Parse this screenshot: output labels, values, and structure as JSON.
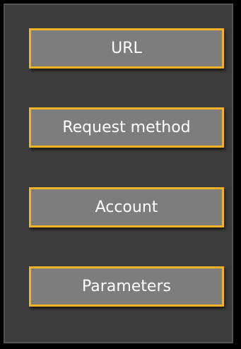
{
  "blocks": [
    {
      "label": "URL"
    },
    {
      "label": "Request method"
    },
    {
      "label": "Account"
    },
    {
      "label": "Parameters"
    }
  ],
  "colors": {
    "background": "#000000",
    "panel": "#3b3b3b",
    "block_fill": "#7d7d7d",
    "block_border": "#f0b323",
    "text": "#ffffff"
  }
}
